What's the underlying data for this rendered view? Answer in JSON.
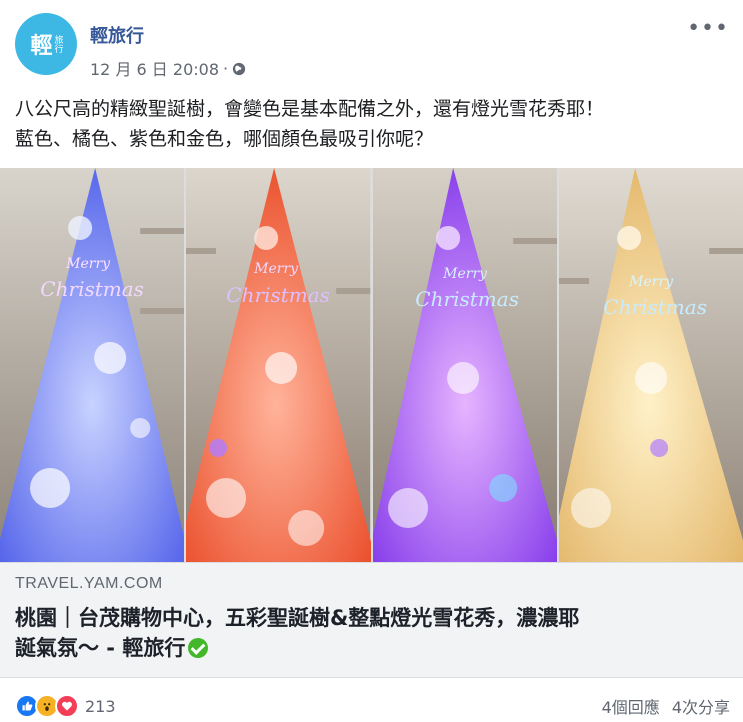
{
  "page": {
    "name": "輕旅行",
    "avatar_text": "輕",
    "avatar_small": "旅行",
    "date": "12 月 6 日 20:08",
    "separator": "·"
  },
  "post": {
    "line1": "八公尺高的精緻聖誕樹，會變色是基本配備之外，還有燈光雪花秀耶！",
    "line2": "藍色、橘色、紫色和金色，哪個顏色最吸引你呢？"
  },
  "photo": {
    "panels": [
      {
        "color": "blue",
        "banner_top": "Merry",
        "banner_bottom": "Christmas"
      },
      {
        "color": "orange",
        "banner_top": "Merry",
        "banner_bottom": "Christmas"
      },
      {
        "color": "purple",
        "banner_top": "Merry",
        "banner_bottom": "Christmas"
      },
      {
        "color": "gold",
        "banner_top": "Merry",
        "banner_bottom": "Christmas"
      }
    ]
  },
  "link": {
    "domain": "TRAVEL.YAM.COM",
    "title_line1": "桃園｜台茂購物中心，五彩聖誕樹&整點燈光雪花秀，濃濃耶",
    "title_line2": "誕氣氛～ - 輕旅行"
  },
  "footer": {
    "reaction_count": "213",
    "comments": "4個回應",
    "shares": "4次分享"
  },
  "colors": {
    "link_blue": "#365899",
    "muted": "#606770",
    "verified_green": "#42b72a",
    "avatar_bg": "#3db7e4"
  }
}
